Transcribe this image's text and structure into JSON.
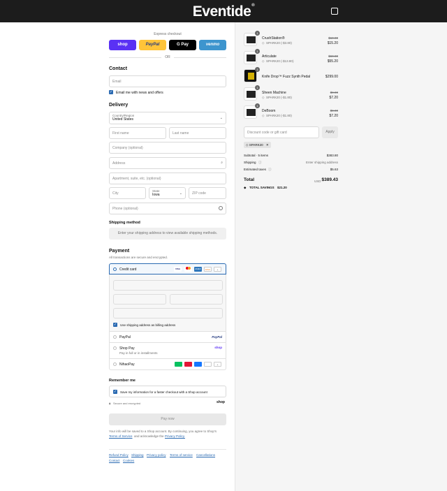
{
  "header": {
    "brand": "Eventide",
    "brand_mark": "®",
    "cart_icon": "bag-icon"
  },
  "express": {
    "title": "Express checkout",
    "buttons": [
      {
        "label": "shop",
        "color": "#5a31f4"
      },
      {
        "label": "PayPal",
        "color": "#ffc439"
      },
      {
        "label": "G Pay",
        "color": "#000000"
      },
      {
        "label": "venmo",
        "color": "#3d95ce"
      }
    ],
    "or": "OR"
  },
  "contact": {
    "title": "Contact",
    "email_placeholder": "Email",
    "email_news": "Email me with news and offers"
  },
  "delivery": {
    "title": "Delivery",
    "country_label": "Country/Region",
    "country_value": "United States",
    "first_name": "First name",
    "last_name": "Last name",
    "company": "Company (optional)",
    "address": "Address",
    "apartment": "Apartment, suite, etc. (optional)",
    "city": "City",
    "state_label": "State",
    "state_value": "Iowa",
    "zip": "ZIP code",
    "phone": "Phone (optional)"
  },
  "shipping": {
    "title": "Shipping method",
    "notice": "Enter your shipping address to view available shipping methods."
  },
  "payment": {
    "title": "Payment",
    "subtitle": "All transactions are secure and encrypted.",
    "credit_card": "Credit card",
    "billing_same": "Use shipping address as billing address",
    "paypal": "PayPal",
    "shop_pay": "Shop Pay",
    "shop_pay_sub": "Pay in full or in installments",
    "nihao": "NihaoPay"
  },
  "remember": {
    "title": "Remember me",
    "save_info": "Save my information for a faster checkout with a Shop account",
    "secure": "Secure and encrypted",
    "shop": "shop"
  },
  "pay_now": "Pay now",
  "legal": {
    "line1": "Your info will be saved to a Shop account. By continuing, you agree to Shop's",
    "terms": "Terms of Service",
    "and": "and acknowledge the",
    "privacy": "Privacy Policy."
  },
  "footer_links": [
    "Refund Policy",
    "Shipping",
    "Privacy policy",
    "Terms of service",
    "Cancellations",
    "Contact",
    "Cookies"
  ],
  "cart": {
    "items": [
      {
        "qty": "1",
        "name": "CrushStation®",
        "discount": "SPARK20 (-$3.80)",
        "old": "$19.00",
        "price": "$15.20"
      },
      {
        "qty": "1",
        "name": "Articulate",
        "discount": "SPARK20 (-$13.80)",
        "old": "$69.00",
        "price": "$55.20"
      },
      {
        "qty": "1",
        "name": "Knife Drop™ Fuzz Synth Pedal",
        "discount": "",
        "old": "",
        "price": "$299.00"
      },
      {
        "qty": "1",
        "name": "Sheen Machine",
        "discount": "SPARK20 (-$1.80)",
        "old": "$9.00",
        "price": "$7.20"
      },
      {
        "qty": "1",
        "name": "DeBoom",
        "discount": "SPARK20 (-$1.80)",
        "old": "$9.00",
        "price": "$7.20"
      }
    ],
    "discount_placeholder": "Discount code or gift card",
    "apply": "Apply",
    "code_tag": "SPARK20",
    "subtotal_label": "Subtotal · 5 items",
    "subtotal": "$383.80",
    "shipping_label": "Shipping",
    "shipping_value": "Enter shipping address",
    "taxes_label": "Estimated taxes",
    "taxes": "$5.63",
    "total_label": "Total",
    "currency": "USD",
    "total": "$389.43",
    "savings_label": "TOTAL SAVINGS",
    "savings": "$21.20"
  }
}
